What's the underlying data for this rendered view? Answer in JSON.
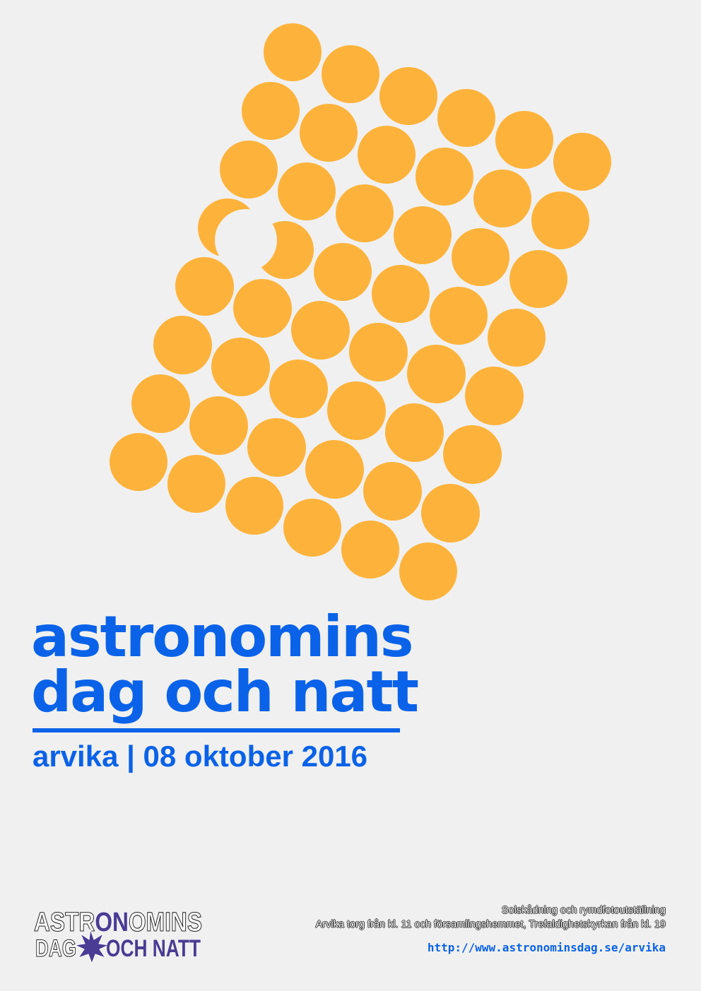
{
  "poster": {
    "title_line1": "astronomins",
    "title_line2": "dag och natt",
    "subtitle": "arvika | 08 oktober 2016",
    "event_line1": "Solskådning och rymdfotoutställning",
    "event_line2": "Arvika torg från kl. 11 och församlingshemmet, Trefaldighetskyrkan från kl. 19",
    "url": "http://www.astronominsdag.se/arvika"
  },
  "logo": {
    "word1_part1": "ASTR",
    "word1_part2": "ON",
    "word1_part3": "OMINS",
    "word2": "DAG",
    "word3": "OCH NATT"
  },
  "colors": {
    "background": "#f0f0f0",
    "accent_blue": "#0a62e8",
    "dot_orange": "#fdb33b",
    "logo_purple": "#4a3b94"
  },
  "icons": [
    "crescent-moon-icon",
    "star-burst-icon"
  ]
}
